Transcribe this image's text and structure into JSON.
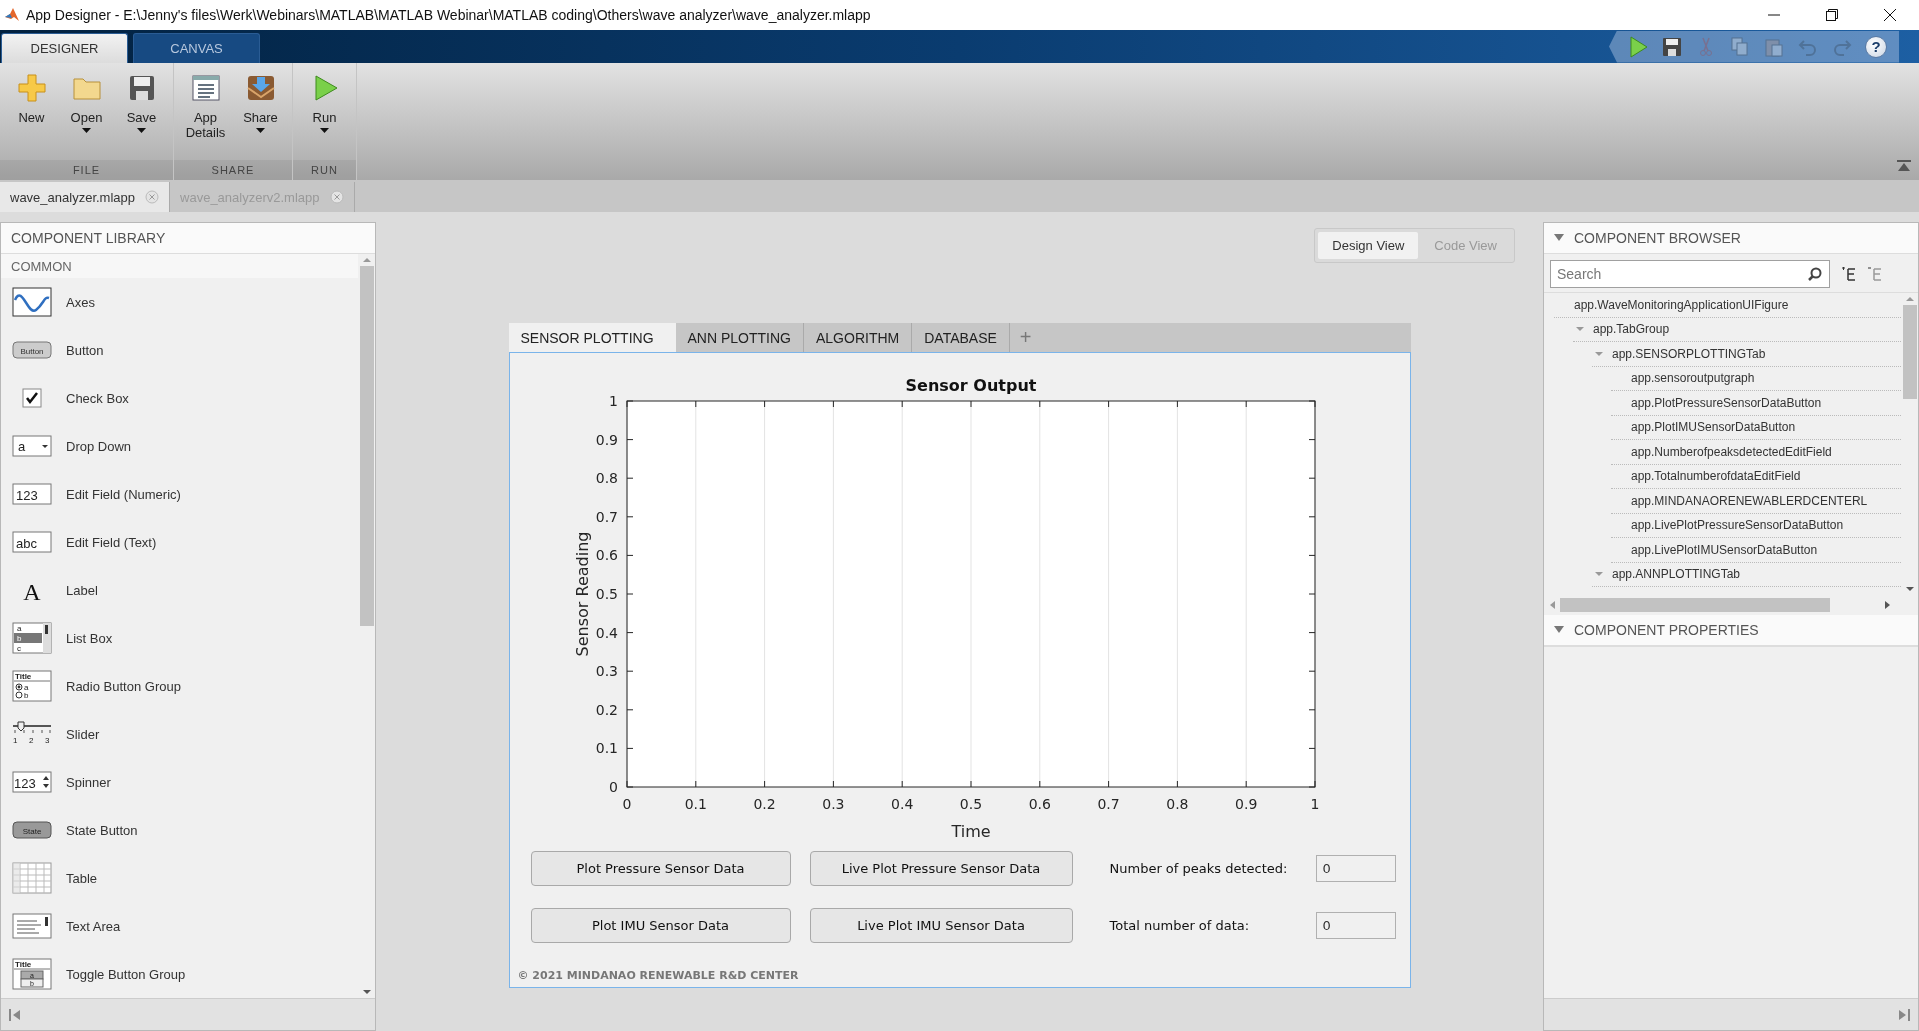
{
  "window": {
    "title": "App Designer - E:\\Jenny's files\\Werk\\Webinars\\MATLAB\\MATLAB Webinar\\MATLAB coding\\Others\\wave analyzer\\wave_analyzer.mlapp"
  },
  "ribbon_tabs": [
    {
      "label": "DESIGNER",
      "selected": true
    },
    {
      "label": "CANVAS",
      "selected": false
    }
  ],
  "quick_access": [
    {
      "kind": "run",
      "disabled": false
    },
    {
      "kind": "save",
      "disabled": false
    },
    {
      "kind": "cut",
      "disabled": true
    },
    {
      "kind": "copy",
      "disabled": true
    },
    {
      "kind": "paste",
      "disabled": true
    },
    {
      "kind": "undo",
      "disabled": true
    },
    {
      "kind": "redo",
      "disabled": true
    },
    {
      "kind": "help",
      "glyph": "?",
      "disabled": false
    }
  ],
  "ribbon_groups": [
    {
      "label": "FILE",
      "buttons": [
        {
          "kind": "new",
          "label": "New",
          "dropdown": false
        },
        {
          "kind": "open",
          "label": "Open",
          "dropdown": true
        },
        {
          "kind": "save",
          "label": "Save",
          "dropdown": true
        }
      ]
    },
    {
      "label": "SHARE",
      "buttons": [
        {
          "kind": "details",
          "label": "App Details",
          "dropdown": false
        },
        {
          "kind": "share",
          "label": "Share",
          "dropdown": true
        }
      ]
    },
    {
      "label": "RUN",
      "buttons": [
        {
          "kind": "run",
          "label": "Run",
          "dropdown": true
        }
      ]
    }
  ],
  "document_tabs": [
    {
      "label": "wave_analyzer.mlapp",
      "selected": true
    },
    {
      "label": "wave_analyzerv2.mlapp",
      "selected": false
    }
  ],
  "library": {
    "title": "COMPONENT LIBRARY",
    "section": "COMMON",
    "items": [
      {
        "kind": "axes",
        "label": "Axes"
      },
      {
        "kind": "button",
        "label": "Button",
        "icon_texts": [
          "Button"
        ]
      },
      {
        "kind": "checkbox",
        "label": "Check Box"
      },
      {
        "kind": "dropdown",
        "label": "Drop Down",
        "icon_texts": [
          "a"
        ]
      },
      {
        "kind": "numeric",
        "label": "Edit Field (Numeric)",
        "icon_texts": [
          "123"
        ]
      },
      {
        "kind": "text",
        "label": "Edit Field (Text)",
        "icon_texts": [
          "abc"
        ]
      },
      {
        "kind": "label",
        "label": "Label",
        "icon_texts": [
          "A"
        ]
      },
      {
        "kind": "listbox",
        "label": "List Box",
        "icon_texts": [
          "a",
          "b",
          "c"
        ]
      },
      {
        "kind": "radiogroup",
        "label": "Radio Button Group",
        "icon_texts": [
          "Title",
          "a",
          "b"
        ]
      },
      {
        "kind": "slider",
        "label": "Slider",
        "icon_texts": [
          "1",
          "2",
          "3"
        ]
      },
      {
        "kind": "spinner",
        "label": "Spinner",
        "icon_texts": [
          "123"
        ]
      },
      {
        "kind": "statebutton",
        "label": "State Button",
        "icon_texts": [
          "State"
        ]
      },
      {
        "kind": "table",
        "label": "Table"
      },
      {
        "kind": "textarea",
        "label": "Text Area"
      },
      {
        "kind": "togglegroup",
        "label": "Toggle Button Group",
        "icon_texts": [
          "Title",
          "a",
          "b"
        ]
      }
    ]
  },
  "view_toggle": [
    {
      "label": "Design View",
      "selected": true
    },
    {
      "label": "Code View",
      "selected": false
    }
  ],
  "app_tabs": {
    "tabs": [
      {
        "label": "SENSOR PLOTTING",
        "selected": true
      },
      {
        "label": "ANN PLOTTING",
        "selected": false
      },
      {
        "label": "ALGORITHM",
        "selected": false
      },
      {
        "label": "DATABASE",
        "selected": false
      }
    ],
    "add": "+"
  },
  "sensor_panel": {
    "chart_data": {
      "type": "line",
      "grid": true,
      "title": "Sensor Output",
      "xlabel": "Time",
      "ylabel": "Sensor Reading",
      "xlim": [
        0,
        1
      ],
      "ylim": [
        0,
        1
      ],
      "xticks": [
        0,
        0.1,
        0.2,
        0.3,
        0.4,
        0.5,
        0.6,
        0.7,
        0.8,
        0.9,
        1
      ],
      "yticks": [
        0,
        0.1,
        0.2,
        0.3,
        0.4,
        0.5,
        0.6,
        0.7,
        0.8,
        0.9,
        1
      ]
    },
    "buttons": [
      "Plot Pressure Sensor Data",
      "Live Plot Pressure Sensor Data",
      "Plot IMU Sensor Data",
      "Live Plot IMU Sensor Data"
    ],
    "fields": [
      {
        "label": "Number of peaks detected:",
        "value": "0"
      },
      {
        "label": "Total number of data:",
        "value": "0"
      }
    ],
    "footer": "© 2021 MINDANAO RENEWABLE R&D CENTER"
  },
  "browser": {
    "title": "COMPONENT BROWSER",
    "expanded": true,
    "search": {
      "placeholder": "Search"
    },
    "tree": [
      {
        "label": "app.WaveMonitoringApplicationUIFigure",
        "children": [
          {
            "label": "app.TabGroup",
            "expanded": true,
            "children": [
              {
                "label": "app.SENSORPLOTTINGTab",
                "expanded": true,
                "children": [
                  {
                    "label": "app.sensoroutputgraph"
                  },
                  {
                    "label": "app.PlotPressureSensorDataButton"
                  },
                  {
                    "label": "app.PlotIMUSensorDataButton"
                  },
                  {
                    "label": "app.NumberofpeaksdetectedEditField"
                  },
                  {
                    "label": "app.TotalnumberofdataEditField"
                  },
                  {
                    "label": "app.MINDANAORENEWABLERDCENTERL"
                  },
                  {
                    "label": "app.LivePlotPressureSensorDataButton"
                  },
                  {
                    "label": "app.LivePlotIMUSensorDataButton"
                  }
                ]
              },
              {
                "label": "app.ANNPLOTTINGTab",
                "expanded": true
              }
            ]
          }
        ]
      }
    ]
  },
  "properties": {
    "title": "COMPONENT PROPERTIES",
    "expanded": true
  }
}
